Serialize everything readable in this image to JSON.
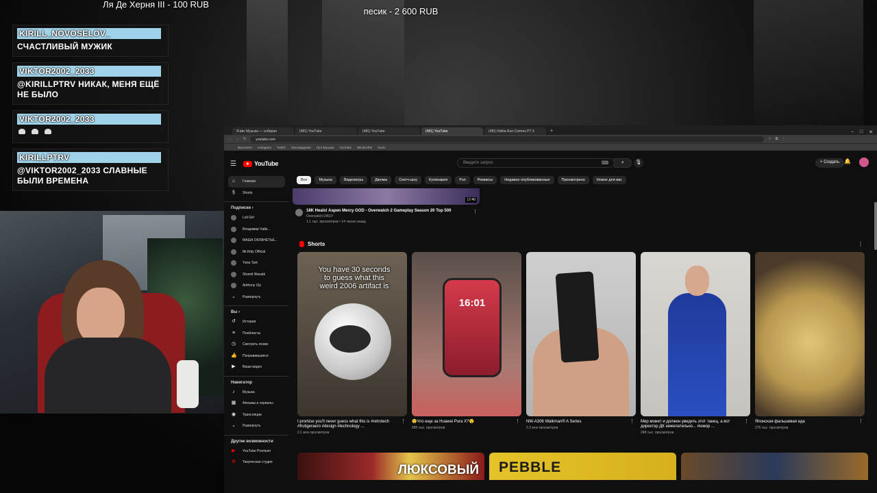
{
  "overlay": {
    "donation_left": "Ля Де Херня III - 100 RUB",
    "donation_top": "песик - 2 600 RUB"
  },
  "chat": [
    {
      "user": "KIRILL_NOVOSELOV_",
      "text": "СЧАСТЛИВЫЙ МУЖИК"
    },
    {
      "user": "VIKTOR2002_2033",
      "text": "@KIRILLPTRV НИКАК, МЕНЯ ЕЩЁ НЕ БЫЛО"
    },
    {
      "user": "VIKTOR2002_2033",
      "text": ""
    },
    {
      "user": "KIRILLPTRV",
      "text": "@VIKTOR2002_2033 СЛАВНЫЕ БЫЛИ ВРЕМЕНА"
    }
  ],
  "browser": {
    "tabs": [
      "Я.ввс Музыка — собирая",
      "(481) YouTube",
      "(481) YouTube",
      "(481) YouTube",
      "(481) Nikita Run Comms PT 3"
    ],
    "url": "youtube.com",
    "bookmarks": [
      "Вконтакте",
      "Instagram",
      "Twitch",
      "Наслаждение",
      "Гугл Музыка",
      "YouTube",
      "Windscribe",
      "Sonic"
    ]
  },
  "youtube": {
    "logo": "YouTube",
    "search_placeholder": "Введите запрос",
    "create_label": "Создать",
    "sidebar": {
      "main": [
        {
          "icon": "home-icon",
          "label": "Главная"
        },
        {
          "icon": "shorts-icon",
          "label": "Shorts"
        }
      ],
      "subs_header": "Подписки",
      "subs": [
        "Loli Girl",
        "Владимир Чайк...",
        "МАША ОКЛАНЕТЬЕ...",
        "Mr.Kitty Official",
        "Yana Tark",
        "Shamil Wasabi",
        "Anthony Uly"
      ],
      "subs_more": "Развернуть",
      "you_header": "Вы",
      "you": [
        "История",
        "Плейлисты",
        "Смотреть позже",
        "Понравившиеся",
        "Ваши видео"
      ],
      "nav_header": "Навигатор",
      "nav": [
        "Музыка",
        "Фильмы и сериалы",
        "Трансляции",
        "Развернуть"
      ],
      "more_header": "Другие возможности",
      "more": [
        "YouTube Premium",
        "Творческая студия"
      ]
    },
    "chips": [
      "Все",
      "Музыка",
      "Видеоигры",
      "Джемы",
      "Скетч-шоу",
      "Кулинария",
      "Рэп",
      "Ремиксы",
      "Недавно опубликованные",
      "Просмотрено",
      "Новое для вас"
    ],
    "prev_video": {
      "duration": "17:40",
      "title": "18K Heals! Aspen Mercy GOD - Overwatch 2 Gameplay Season 20 Top 500",
      "channel": "Overwatch DAILY",
      "meta": "1,1 тыс. просмотров • 14 часов назад"
    },
    "shorts_title": "Shorts",
    "shorts": [
      {
        "caption": "You have 30 seconds to guess what this weird 2006 artifact is",
        "title": "I promise you'll never guess what this is #retrotech #frutigeraero #design #technology ...",
        "views": "2,1 млн просмотров"
      },
      {
        "caption": "16:01",
        "title": "😯Что еще за Huawei Pura X?😯",
        "views": "685 тыс. просмотров"
      },
      {
        "caption": "",
        "title": "NW-A306 Walkman® A Series",
        "views": "2,3 млн просмотров"
      },
      {
        "caption": "",
        "title": "Мир может и должен увидеть этот танец, а вот директор ДК нежелательно... #юмор ...",
        "views": "248 тыс. просмотров"
      },
      {
        "caption": "",
        "title": "Японская фальшивая еда",
        "views": "275 тыс. просмотров"
      }
    ],
    "bottom": [
      "ЛЮКСОВЫЙ",
      "PEBBLE",
      ""
    ]
  }
}
